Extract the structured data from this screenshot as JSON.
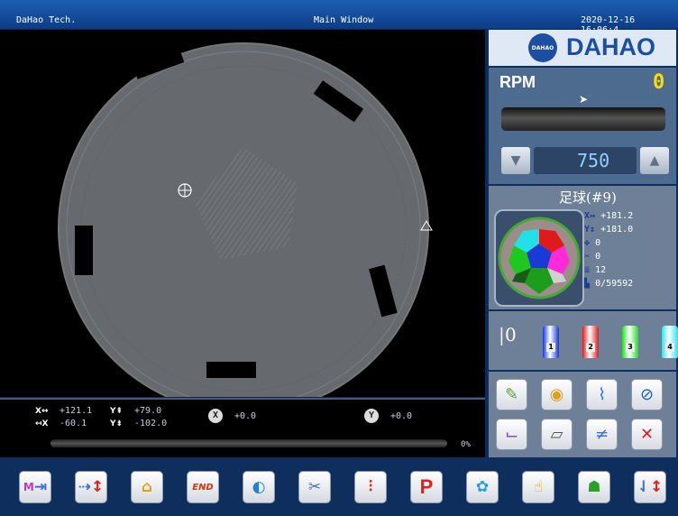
{
  "titlebar": {
    "company": "DaHao Tech.",
    "window_title": "Main Window",
    "datetime": "2020-12-16 16:06:4"
  },
  "logo": {
    "text": "DAHAO",
    "badge": "DAHAO"
  },
  "rpm": {
    "label": "RPM",
    "value": "0",
    "set_value": "750"
  },
  "design": {
    "name": "足球(#9)",
    "x_size": "+181.2",
    "y_size": "+181.0",
    "color_changes": "0",
    "trims": "0",
    "layers": "12",
    "stitches": "0/59592"
  },
  "coords": {
    "x_pos": "+121.1",
    "x_neg": "-60.1",
    "y_pos": "+79.0",
    "y_neg": "-102.0",
    "x_offset": "+0.0",
    "y_offset": "+0.0",
    "x_pos_icon": "X↔",
    "x_neg_icon": "↤X",
    "y_pos_icon": "Y⇞",
    "y_neg_icon": "Y⇟",
    "x_circle": "X",
    "y_circle": "Y",
    "progress_fraction": 0,
    "progress_label": "0%"
  },
  "threads": {
    "needle_label": "0",
    "spools": [
      {
        "num": "1",
        "color": "#1338d8"
      },
      {
        "num": "2",
        "color": "#e01a1a"
      },
      {
        "num": "3",
        "color": "#22e022"
      },
      {
        "num": "4",
        "color": "#2ee3e8"
      }
    ]
  },
  "tools": [
    "thread-cut-icon",
    "frame-trace-icon",
    "needle-stitch-icon",
    "no-sew-icon",
    "manual-stitch-icon",
    "pattern-icon",
    "needle-jump-icon",
    "cancel-icon"
  ],
  "toolbar": [
    "manual-color-change-icon",
    "color-order-icon",
    "home-icon",
    "end-icon",
    "speed-icon",
    "thread-trim-icon",
    "needle-select-icon",
    "P",
    "pattern-library-icon",
    "touch-icon",
    "operator-icon",
    "needle-up-down-icon"
  ]
}
